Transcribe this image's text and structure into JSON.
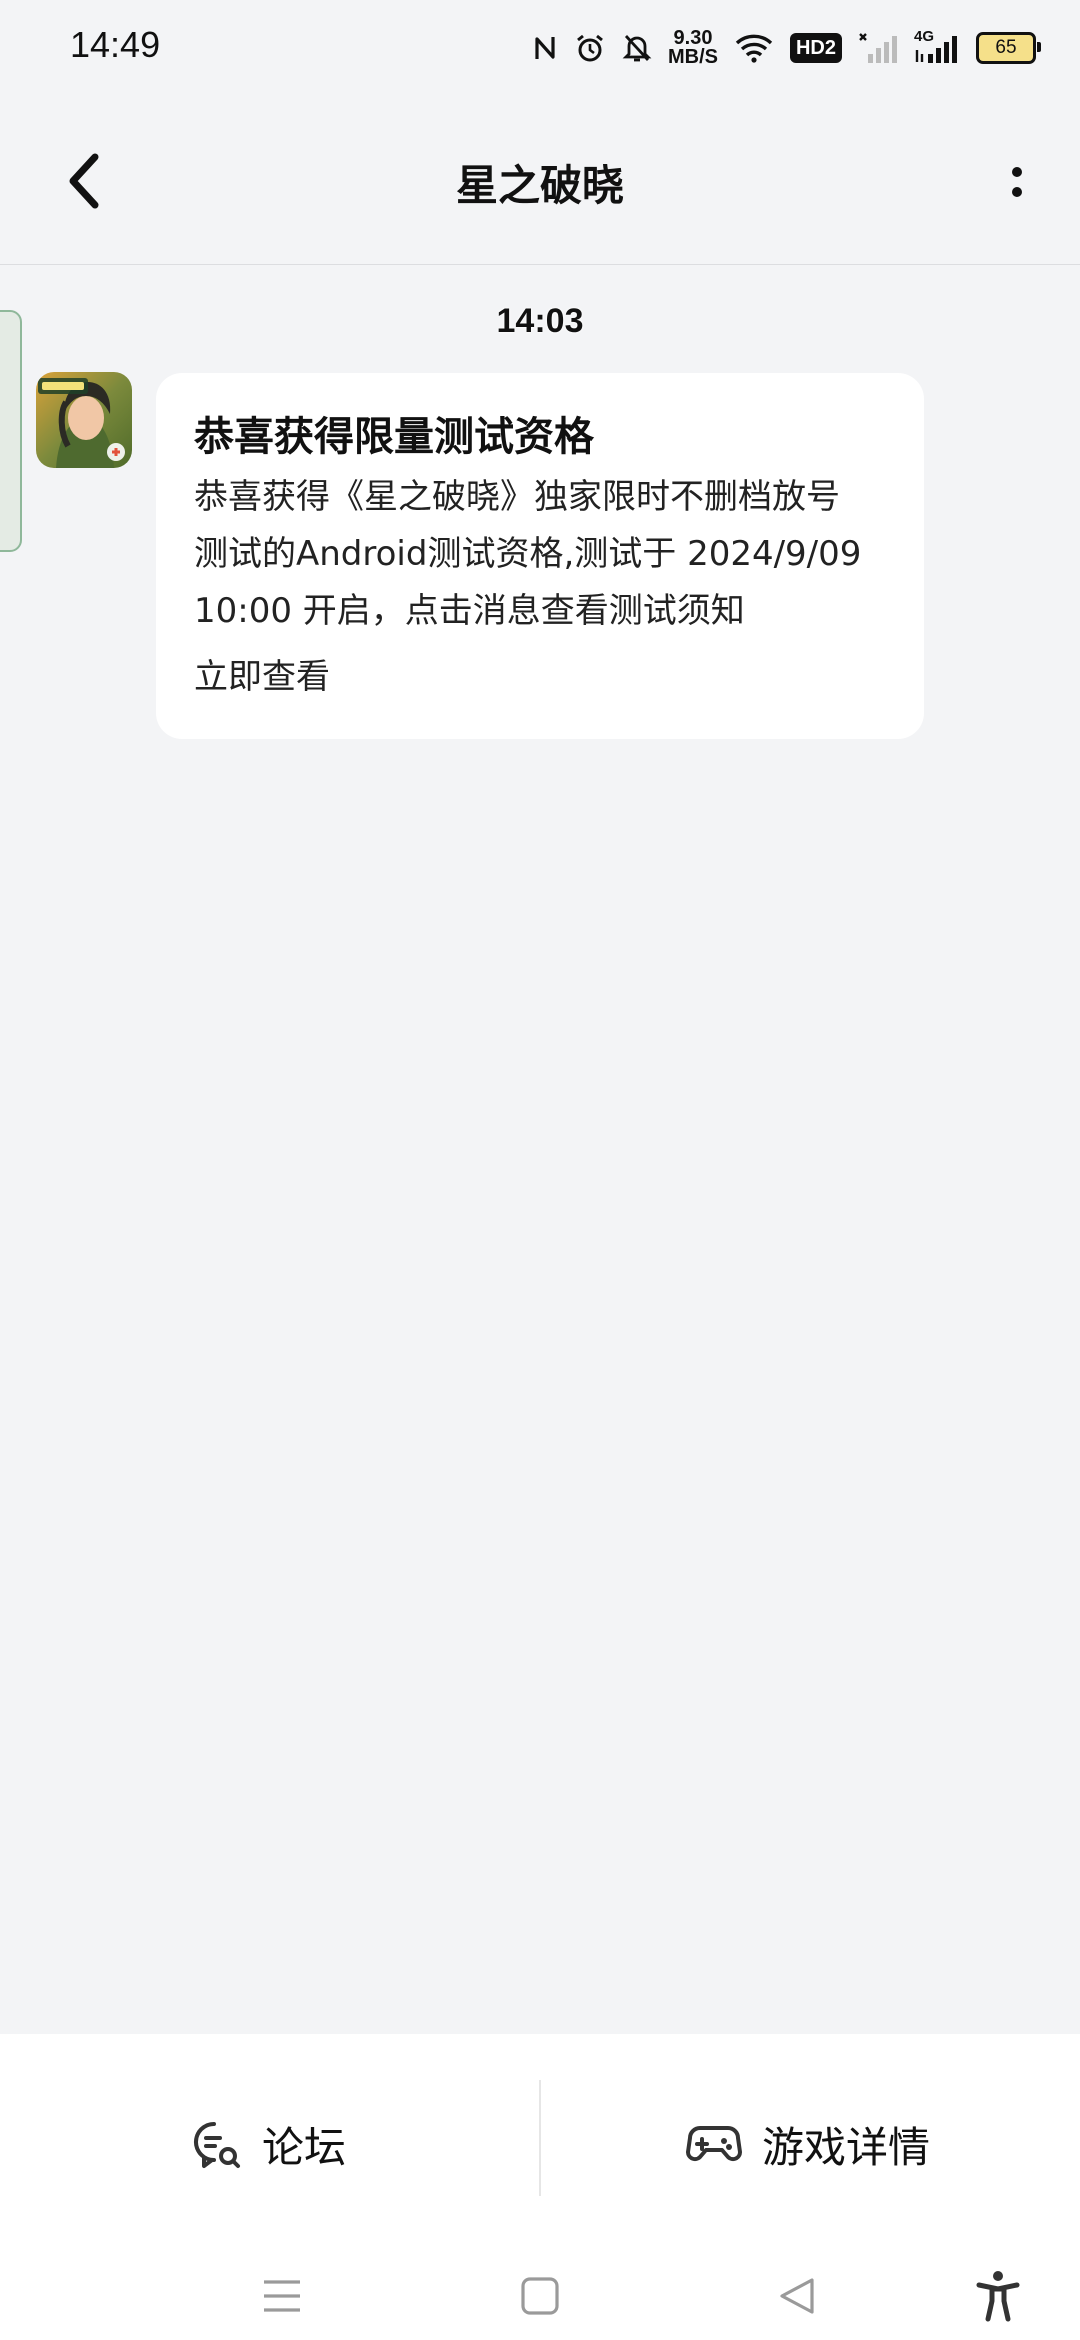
{
  "status_bar": {
    "time": "14:49",
    "net_speed_value": "9.30",
    "net_speed_unit": "MB/S",
    "hd_label": "HD2",
    "network_label": "4G",
    "battery_level": "65",
    "icons": [
      "nfc-icon",
      "alarm-icon",
      "mute-icon",
      "wifi-icon",
      "hd-icon",
      "signal-weak-icon",
      "signal-4g-icon",
      "battery-icon"
    ]
  },
  "header": {
    "title": "星之破晓",
    "back_icon": "chevron-left-icon",
    "more_icon": "more-vertical-icon"
  },
  "conversation": {
    "timestamp": "14:03",
    "message": {
      "avatar": "game-avatar",
      "title": "恭喜获得限量测试资格",
      "body_lines": [
        "恭喜获得《星之破晓》独家限时不删档放号",
        "测试的Android测试资格,测试于 2024/9/09",
        "10:00 开启，点击消息查看测试须知"
      ],
      "link_label": "立即查看"
    }
  },
  "bottom_bar": {
    "forum_label": "论坛",
    "forum_icon": "chat-search-icon",
    "detail_label": "游戏详情",
    "detail_icon": "gamepad-icon"
  },
  "nav_bar": {
    "icons": [
      "menu-icon",
      "home-icon",
      "back-triangle-icon",
      "accessibility-icon"
    ]
  },
  "colors": {
    "background": "#f3f4f6",
    "card": "#ffffff",
    "text": "#111111",
    "battery_fill": "#f5e08a"
  }
}
